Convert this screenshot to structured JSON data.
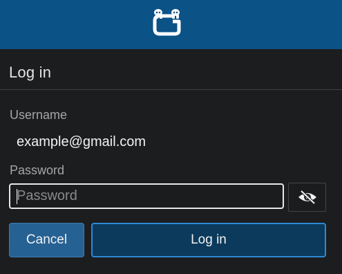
{
  "header": {
    "logo_icon": "guacamole-logo-icon",
    "background_color": "#0b5287"
  },
  "dialog": {
    "title": "Log in",
    "username_label": "Username",
    "username_value": "example@gmail.com",
    "password_label": "Password",
    "password_placeholder": "Password",
    "password_value": "",
    "toggle_visibility_icon": "eye-slash-icon",
    "cancel_label": "Cancel",
    "login_label": "Log in"
  }
}
